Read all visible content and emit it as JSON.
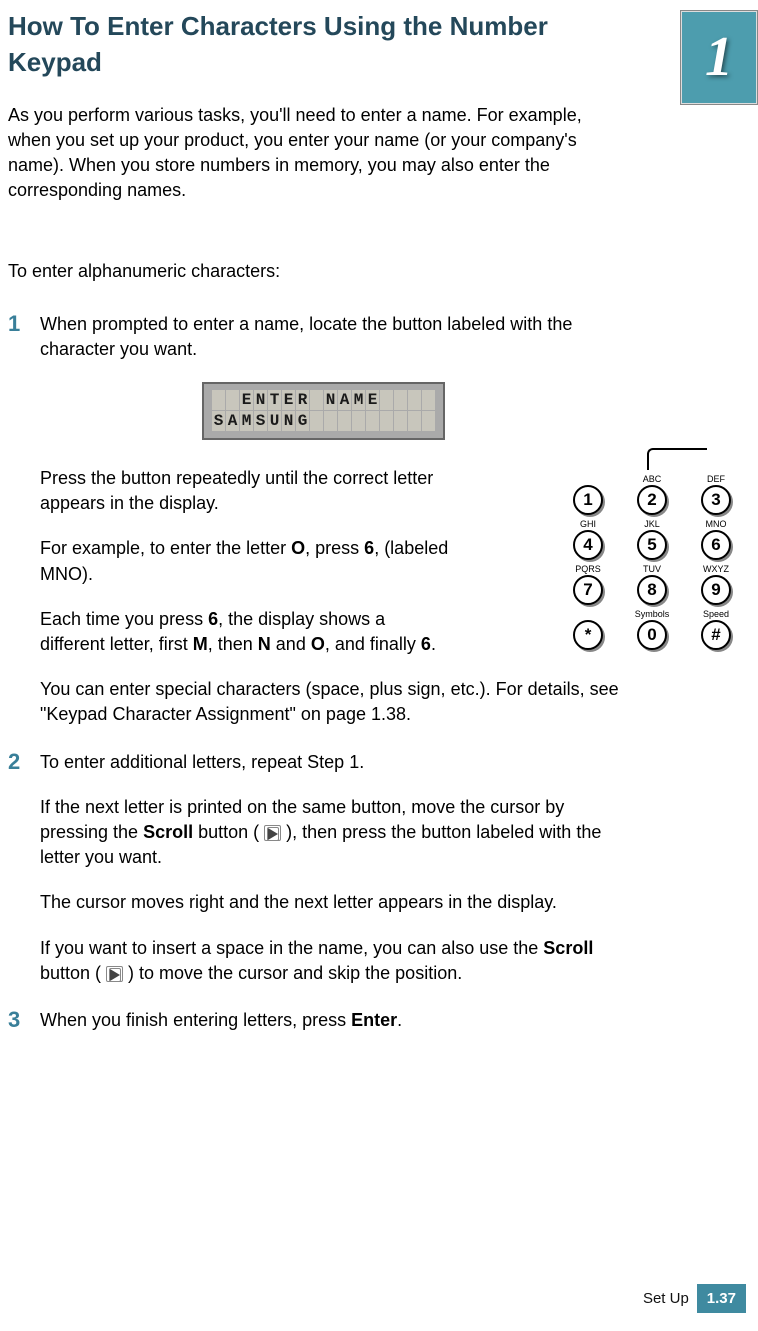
{
  "chapter_tab": "1",
  "title": "How To Enter Characters Using the Number Keypad",
  "intro": "As you perform various tasks, you'll need to enter a name. For example, when you set up your product, you enter your name (or your company's name). When you store numbers in memory, you may also enter the corresponding names.",
  "lead": "To enter alphanumeric characters:",
  "lcd": {
    "row1": "  ENTER NAME    ",
    "row2": "SAMSUNG         "
  },
  "keypad": {
    "cells": [
      {
        "label": "",
        "btn": "1"
      },
      {
        "label": "ABC",
        "btn": "2"
      },
      {
        "label": "DEF",
        "btn": "3"
      },
      {
        "label": "GHI",
        "btn": "4"
      },
      {
        "label": "JKL",
        "btn": "5"
      },
      {
        "label": "MNO",
        "btn": "6"
      },
      {
        "label": "PQRS",
        "btn": "7"
      },
      {
        "label": "TUV",
        "btn": "8"
      },
      {
        "label": "WXYZ",
        "btn": "9"
      },
      {
        "label": "",
        "btn": "*"
      },
      {
        "label": "Symbols",
        "btn": "0"
      },
      {
        "label": "Speed",
        "btn": "#"
      }
    ]
  },
  "steps": {
    "s1": {
      "num": "1",
      "p1": "When prompted to enter a name, locate the button labeled with the character you want.",
      "p2a": "Press the button repeatedly until the correct letter appears in the display.",
      "p2b_pre": "For example, to enter the letter ",
      "p2b_O": "O",
      "p2b_mid": ", press ",
      "p2b_6": "6",
      "p2b_post": ", (labeled MNO).",
      "p2c_pre": "Each time you press ",
      "p2c_6": "6",
      "p2c_mid1": ", the display shows a different letter, first ",
      "p2c_M": "M",
      "p2c_mid2": ", then ",
      "p2c_N": "N",
      "p2c_mid3": " and ",
      "p2c_O": "O",
      "p2c_mid4": ", and finally ",
      "p2c_6b": "6",
      "p2c_post": ".",
      "p3": "You can enter special characters (space, plus sign, etc.). For details, see \"Keypad Character Assignment\" on page 1.38."
    },
    "s2": {
      "num": "2",
      "p1": "To enter additional letters, repeat Step 1.",
      "p2_pre": "If the next letter is printed on the same button, move the cursor by pressing the ",
      "p2_scroll": "Scroll",
      "p2_mid": " button ( ",
      "p2_post": " ), then press the button labeled with the letter you want.",
      "p3": "The cursor moves right and the next letter appears in the display.",
      "p4_pre": "If you want to insert a space in the name, you can also use the ",
      "p4_scroll": "Scroll",
      "p4_mid": " button ( ",
      "p4_post": " ) to move the cursor and skip the position."
    },
    "s3": {
      "num": "3",
      "p1_pre": "When you finish entering letters, press ",
      "p1_enter": "Enter",
      "p1_post": "."
    }
  },
  "footer": {
    "section": "Set Up",
    "page": "1.37"
  }
}
